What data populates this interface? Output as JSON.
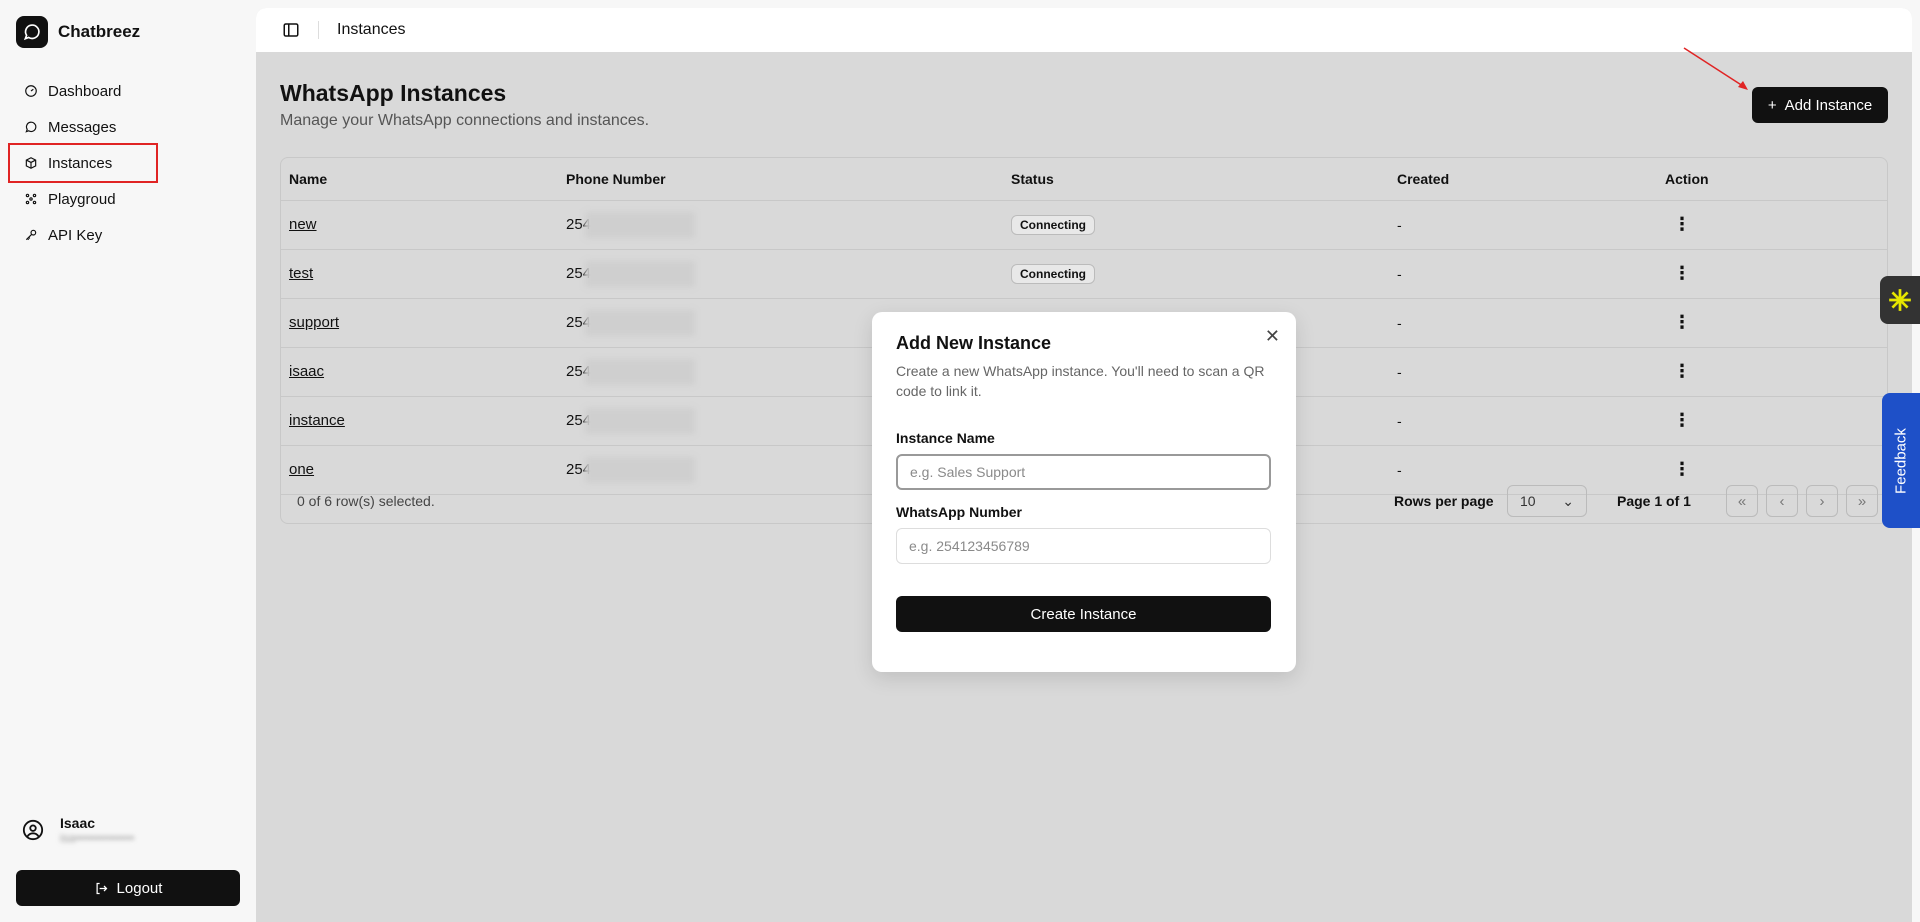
{
  "brand": {
    "name": "Chatbreez"
  },
  "sidebar": {
    "items": [
      {
        "label": "Dashboard",
        "icon": "gauge-icon"
      },
      {
        "label": "Messages",
        "icon": "chat-icon"
      },
      {
        "label": "Instances",
        "icon": "box-icon",
        "active": true
      },
      {
        "label": "Playgroud",
        "icon": "sparkle-icon"
      },
      {
        "label": "API Key",
        "icon": "key-icon"
      }
    ],
    "user": {
      "name": "Isaac",
      "email": "isa••••••••••••••"
    },
    "logout_label": "Logout"
  },
  "topbar": {
    "breadcrumb": "Instances"
  },
  "page": {
    "title": "WhatsApp Instances",
    "subtitle": "Manage your WhatsApp connections and instances.",
    "add_button": "Add Instance"
  },
  "table": {
    "headers": [
      "Name",
      "Phone Number",
      "Status",
      "Created",
      "Action"
    ],
    "rows": [
      {
        "name": "new",
        "phone": "254",
        "status": "Connecting",
        "created": "-"
      },
      {
        "name": "test",
        "phone": "254",
        "status": "Connecting",
        "created": "-"
      },
      {
        "name": "support",
        "phone": "254",
        "status": "",
        "created": "-"
      },
      {
        "name": "isaac",
        "phone": "254",
        "status": "",
        "created": "-"
      },
      {
        "name": "instance",
        "phone": "254",
        "status": "",
        "created": "-"
      },
      {
        "name": "one",
        "phone": "254",
        "status": "",
        "created": "-"
      }
    ],
    "selection": "0 of 6 row(s) selected.",
    "rows_per_page_label": "Rows per page",
    "rows_per_page_value": "10",
    "page_info": "Page 1 of 1"
  },
  "modal": {
    "title": "Add New Instance",
    "description": "Create a new WhatsApp instance. You'll need to scan a QR code to link it.",
    "instance_name_label": "Instance Name",
    "instance_name_placeholder": "e.g. Sales Support",
    "whatsapp_number_label": "WhatsApp Number",
    "whatsapp_number_placeholder": "e.g. 254123456789",
    "create_button": "Create Instance"
  },
  "feedback": {
    "label": "Feedback"
  },
  "colors": {
    "accent": "#111111",
    "highlight": "#e02424",
    "feedback": "#1e50c8"
  }
}
